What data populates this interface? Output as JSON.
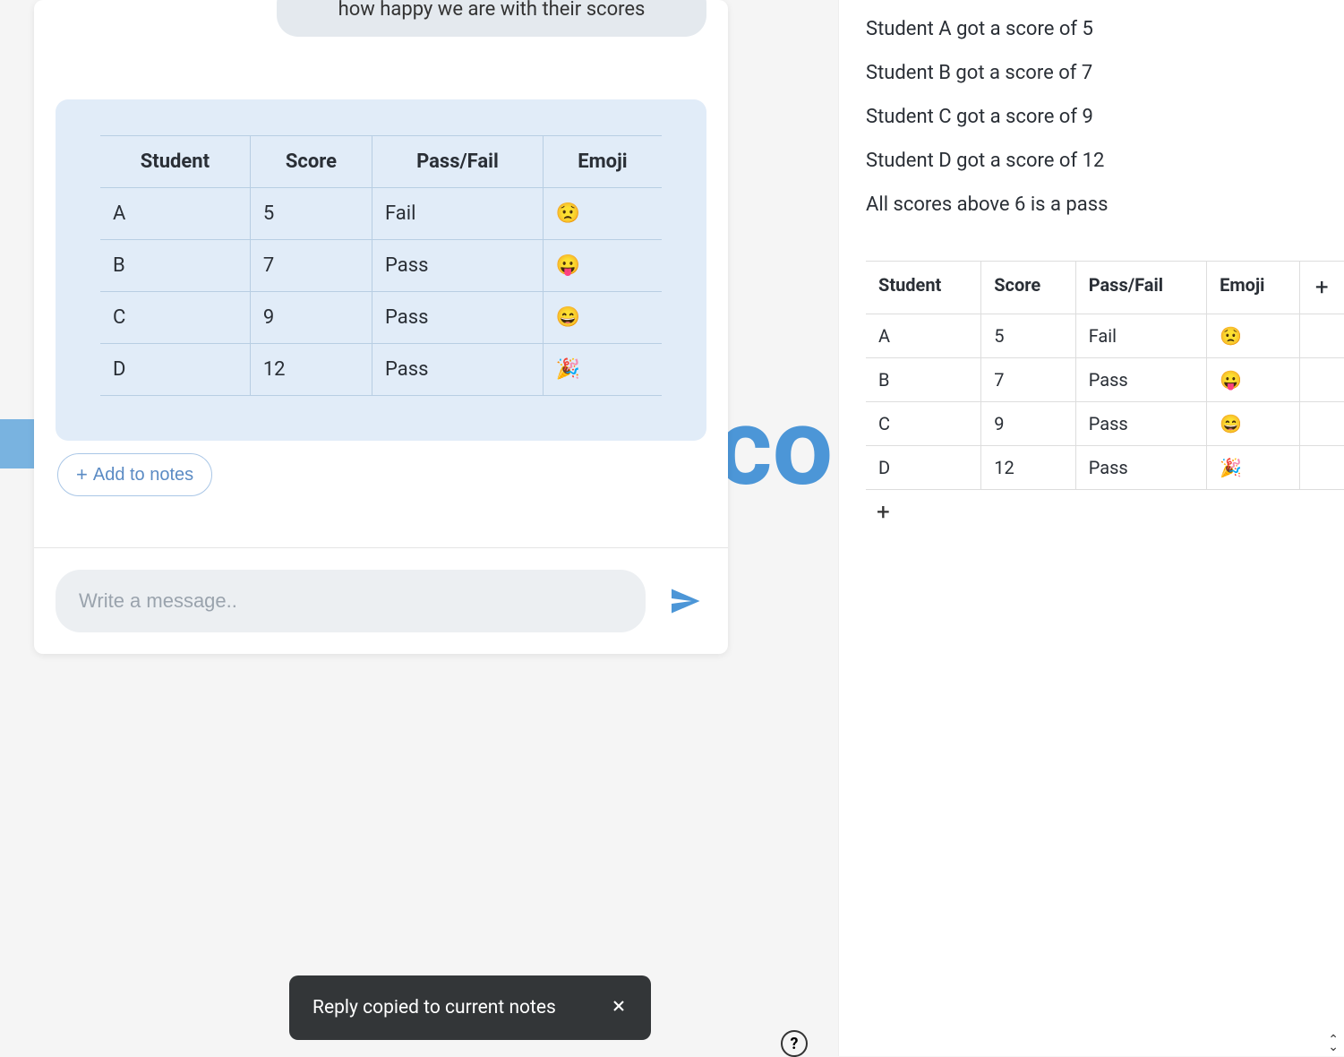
{
  "background_text": "cor",
  "chat": {
    "user_message": "how happy we are with their scores",
    "table": {
      "headers": [
        "Student",
        "Score",
        "Pass/Fail",
        "Emoji"
      ],
      "rows": [
        {
          "student": "A",
          "score": "5",
          "passfail": "Fail",
          "emoji": "😟"
        },
        {
          "student": "B",
          "score": "7",
          "passfail": "Pass",
          "emoji": "😛"
        },
        {
          "student": "C",
          "score": "9",
          "passfail": "Pass",
          "emoji": "😄"
        },
        {
          "student": "D",
          "score": "12",
          "passfail": "Pass",
          "emoji": "🎉"
        }
      ]
    },
    "add_to_notes": "Add to notes",
    "input_placeholder": "Write a message.."
  },
  "notes": {
    "lines": [
      "Student A got a score of 5",
      "Student B got a score of 7",
      "Student C got a score of 9",
      "Student D got a score of 12",
      "All scores above 6 is a pass"
    ],
    "table": {
      "headers": [
        "Student",
        "Score",
        "Pass/Fail",
        "Emoji"
      ],
      "rows": [
        {
          "student": "A",
          "score": "5",
          "passfail": "Fail",
          "emoji": "😟"
        },
        {
          "student": "B",
          "score": "7",
          "passfail": "Pass",
          "emoji": "😛"
        },
        {
          "student": "C",
          "score": "9",
          "passfail": "Pass",
          "emoji": "😄"
        },
        {
          "student": "D",
          "score": "12",
          "passfail": "Pass",
          "emoji": "🎉"
        }
      ]
    }
  },
  "toast": {
    "message": "Reply copied to current notes"
  },
  "help_label": "?"
}
